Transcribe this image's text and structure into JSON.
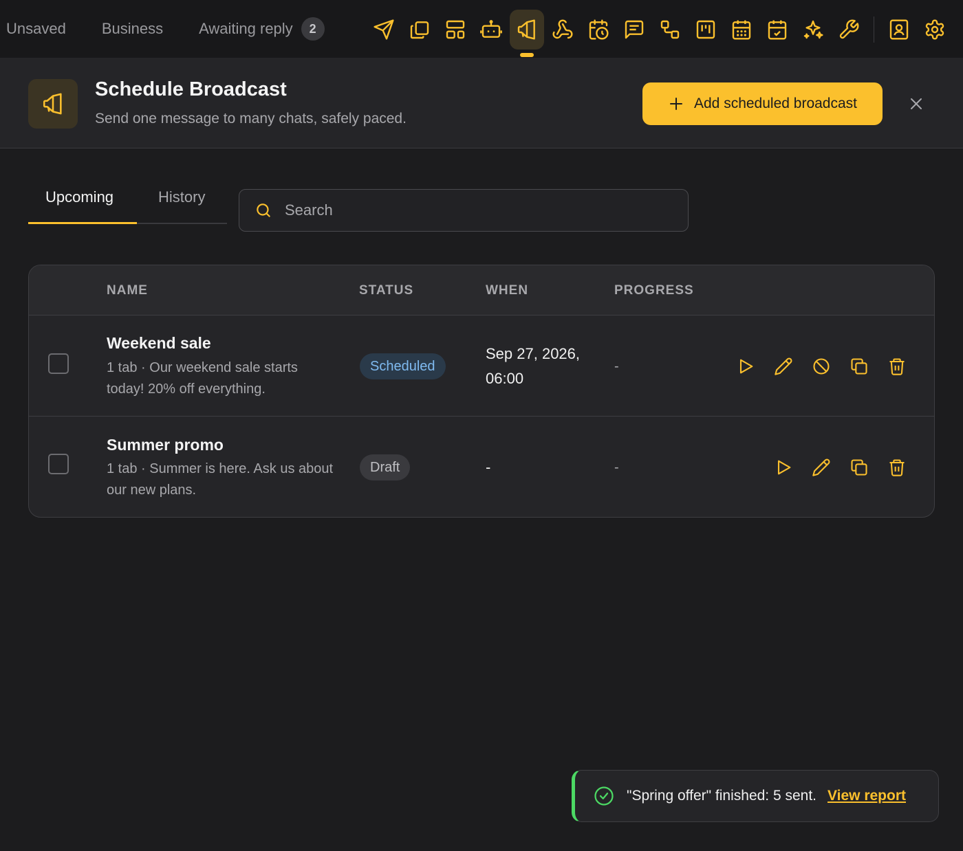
{
  "topbar": {
    "chat_tabs": [
      {
        "label": "Unsaved"
      },
      {
        "label": "Business"
      },
      {
        "label": "Awaiting reply",
        "count": "2"
      }
    ],
    "tools": [
      "send-icon",
      "copy-icon",
      "layout-icon",
      "bot-icon",
      "megaphone-icon",
      "webhook-icon",
      "calendar-clock-icon",
      "message-icon",
      "flow-icon",
      "kanban-icon",
      "calendar-icon",
      "calendar-check-icon",
      "sparkles-icon",
      "wrench-icon",
      "contact-icon",
      "gear-icon"
    ],
    "active_tool": "megaphone-icon"
  },
  "header": {
    "title": "Schedule Broadcast",
    "subtitle": "Send one message to many chats, safely paced.",
    "add_label": "Add scheduled broadcast"
  },
  "view_tabs": {
    "upcoming": "Upcoming",
    "history": "History",
    "active": "upcoming"
  },
  "search": {
    "placeholder": "Search",
    "value": ""
  },
  "table": {
    "columns": {
      "name": "NAME",
      "status": "STATUS",
      "when": "WHEN",
      "progress": "PROGRESS"
    },
    "rows": [
      {
        "name": "Weekend sale",
        "description": "1 tab · Our weekend sale starts today! 20% off everything.",
        "status": "Scheduled",
        "when": "Sep 27, 2026, 06:00",
        "progress": "-",
        "actions": [
          "play-icon",
          "pencil-icon",
          "cancel-icon",
          "duplicate-icon",
          "trash-icon"
        ]
      },
      {
        "name": "Summer promo",
        "description": "1 tab · Summer is here. Ask us about our new plans.",
        "status": "Draft",
        "when": "-",
        "progress": "-",
        "actions": [
          "play-icon",
          "pencil-icon",
          "duplicate-icon",
          "trash-icon"
        ]
      }
    ]
  },
  "toast": {
    "message": "\"Spring offer\" finished: 5 sent.",
    "link": "View report"
  },
  "colors": {
    "accent": "#fbc02d",
    "background": "#1c1c1e",
    "success": "#4cd964",
    "scheduled_badge": "#7fbaf0"
  }
}
